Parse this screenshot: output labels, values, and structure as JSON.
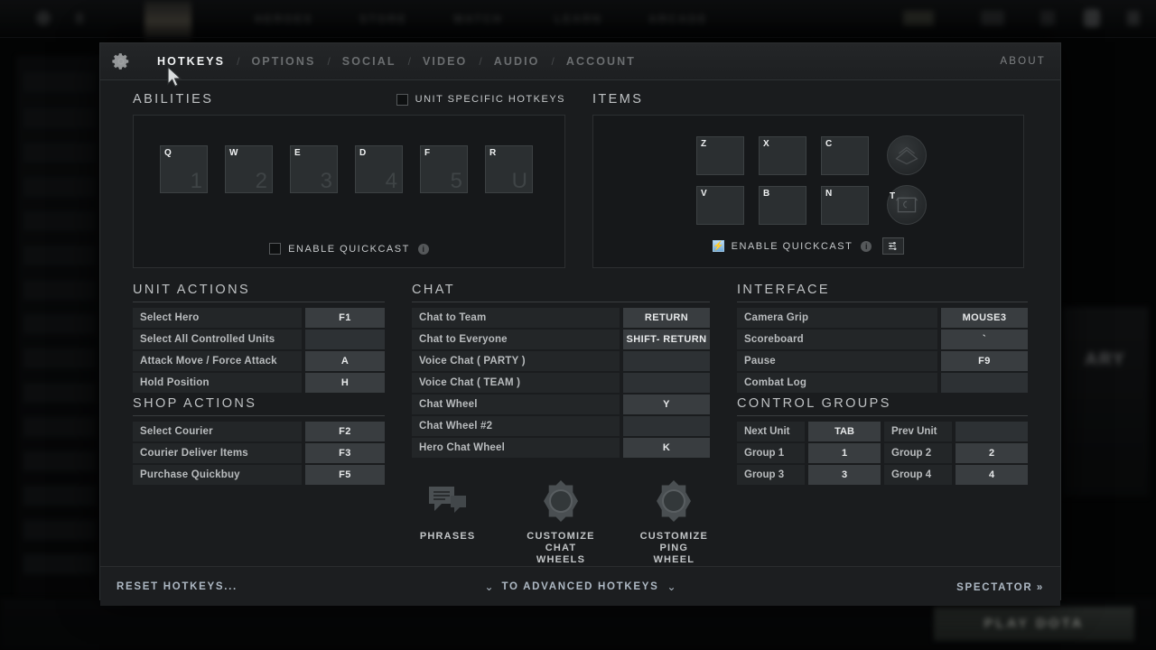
{
  "background": {
    "nav_items": [
      "HEROES",
      "STORE",
      "WATCH",
      "LEARN",
      "ARCADE"
    ],
    "play_button": "PLAY DOTA",
    "right_panel_title": "ARY"
  },
  "dialog": {
    "gear_icon": "gear-icon",
    "tabs": [
      {
        "label": "HOTKEYS",
        "active": true
      },
      {
        "label": "OPTIONS",
        "active": false
      },
      {
        "label": "SOCIAL",
        "active": false
      },
      {
        "label": "VIDEO",
        "active": false
      },
      {
        "label": "AUDIO",
        "active": false
      },
      {
        "label": "ACCOUNT",
        "active": false
      }
    ],
    "tab_separator": "/",
    "about_label": "ABOUT"
  },
  "abilities": {
    "title": "ABILITIES",
    "unit_specific_hotkeys": {
      "label": "UNIT SPECIFIC HOTKEYS",
      "checked": false
    },
    "keys": [
      {
        "key": "Q",
        "ghost": "1"
      },
      {
        "key": "W",
        "ghost": "2"
      },
      {
        "key": "E",
        "ghost": "3"
      },
      {
        "key": "D",
        "ghost": "4"
      },
      {
        "key": "F",
        "ghost": "5"
      },
      {
        "key": "R",
        "ghost": "U"
      }
    ],
    "quickcast": {
      "label": "ENABLE QUICKCAST",
      "checked": false,
      "info_icon": "info-icon"
    }
  },
  "items": {
    "title": "ITEMS",
    "row1": [
      {
        "key": "Z"
      },
      {
        "key": "X"
      },
      {
        "key": "C"
      }
    ],
    "row2": [
      {
        "key": "V"
      },
      {
        "key": "B"
      },
      {
        "key": "N"
      }
    ],
    "circle1": {
      "key": "",
      "icon": "backpack-icon"
    },
    "circle2": {
      "key": "T",
      "icon": "teleport-scroll-icon"
    },
    "quickcast": {
      "label": "ENABLE QUICKCAST",
      "checked": true,
      "info_icon": "info-icon",
      "settings_icon": "sliders-icon"
    }
  },
  "unit_actions": {
    "title": "UNIT ACTIONS",
    "rows": [
      {
        "name": "Select Hero",
        "key": "F1"
      },
      {
        "name": "Select All Controlled Units",
        "key": ""
      },
      {
        "name": "Attack Move / Force Attack",
        "key": "A"
      },
      {
        "name": "Hold Position",
        "key": "H"
      }
    ]
  },
  "shop_actions": {
    "title": "SHOP ACTIONS",
    "rows": [
      {
        "name": "Select Courier",
        "key": "F2"
      },
      {
        "name": "Courier Deliver Items",
        "key": "F3"
      },
      {
        "name": "Purchase Quickbuy",
        "key": "F5"
      }
    ]
  },
  "chat": {
    "title": "CHAT",
    "rows": [
      {
        "name": "Chat to Team",
        "key": "RETURN"
      },
      {
        "name": "Chat to Everyone",
        "key": "SHIFT- RETURN"
      },
      {
        "name": "Voice Chat ( PARTY )",
        "key": ""
      },
      {
        "name": "Voice Chat ( TEAM )",
        "key": ""
      },
      {
        "name": "Chat Wheel",
        "key": "Y"
      },
      {
        "name": "Chat Wheel #2",
        "key": ""
      },
      {
        "name": "Hero Chat Wheel",
        "key": "K"
      }
    ]
  },
  "interface": {
    "title": "INTERFACE",
    "rows": [
      {
        "name": "Camera Grip",
        "key": "MOUSE3"
      },
      {
        "name": "Scoreboard",
        "key": "`"
      },
      {
        "name": "Pause",
        "key": "F9"
      },
      {
        "name": "Combat Log",
        "key": ""
      }
    ]
  },
  "control_groups": {
    "title": "CONTROL GROUPS",
    "rows": [
      [
        {
          "name": "Next Unit",
          "key": "TAB"
        },
        {
          "name": "Prev Unit",
          "key": ""
        }
      ],
      [
        {
          "name": "Group 1",
          "key": "1"
        },
        {
          "name": "Group 2",
          "key": "2"
        }
      ],
      [
        {
          "name": "Group 3",
          "key": "3"
        },
        {
          "name": "Group 4",
          "key": "4"
        }
      ]
    ]
  },
  "wheel_buttons": [
    {
      "label": "PHRASES",
      "icon": "chat-bubbles-icon"
    },
    {
      "label": "CUSTOMIZE\nCHAT WHEELS",
      "line1": "CUSTOMIZE",
      "line2": "CHAT WHEELS",
      "icon": "wheel-icon"
    },
    {
      "label": "CUSTOMIZE\nPING WHEEL",
      "line1": "CUSTOMIZE",
      "line2": "PING WHEEL",
      "icon": "wheel-icon"
    }
  ],
  "footer": {
    "reset_label": "RESET HOTKEYS...",
    "advanced_label": "TO ADVANCED HOTKEYS",
    "chevron": "⌄",
    "spectator_label": "SPECTATOR",
    "spectator_chevron": "»"
  },
  "colors": {
    "accent_blue": "#8fc4e8",
    "footer_link": "#aeb9c4",
    "panel_bg": "#1a1c1e",
    "key_field": "#393d40"
  }
}
